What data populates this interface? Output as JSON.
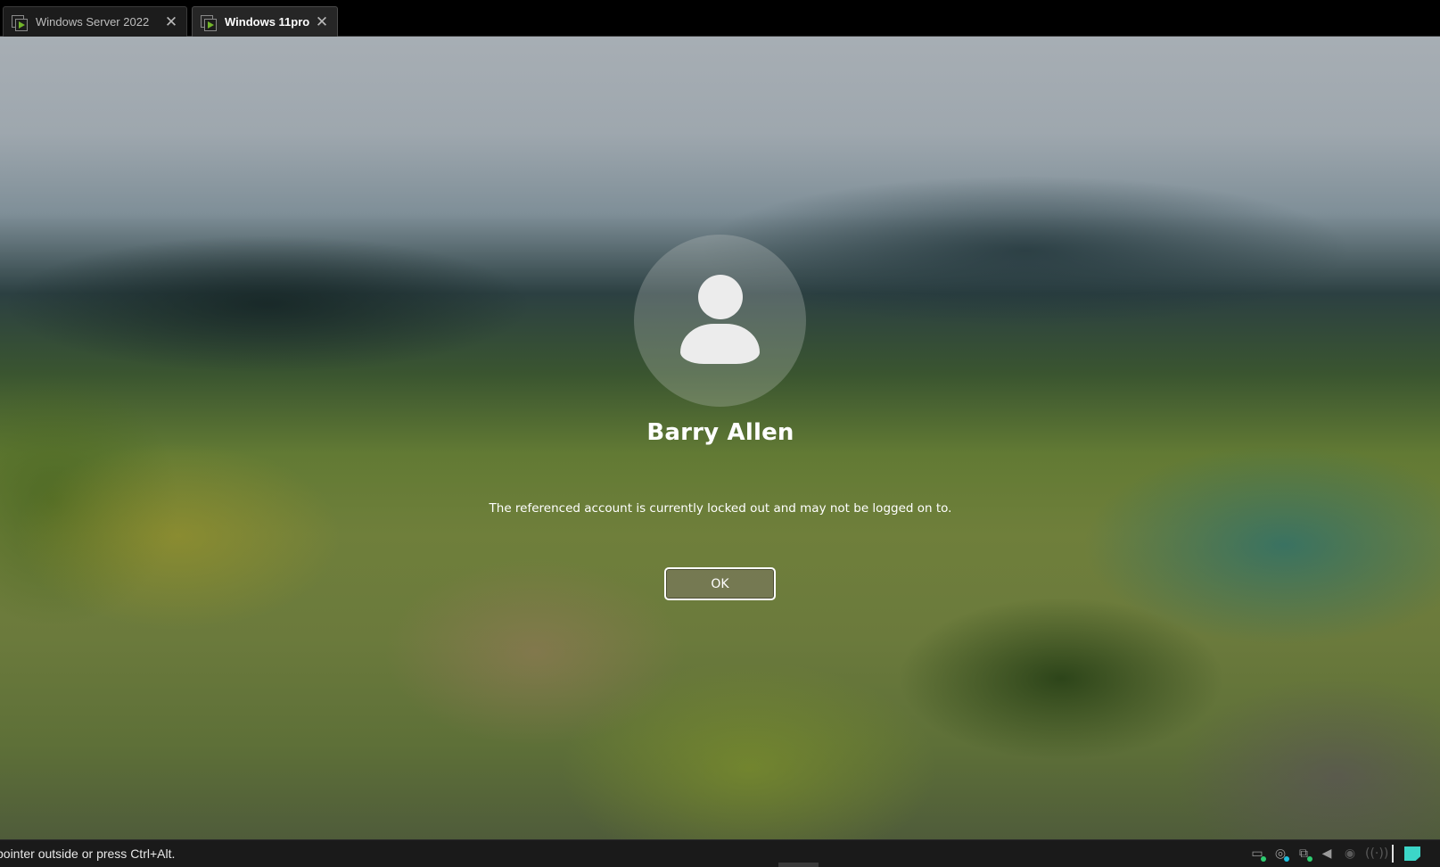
{
  "tabs": [
    {
      "label": "Windows Server 2022",
      "active": false,
      "icon": "vm-icon"
    },
    {
      "label": "Windows 11pro",
      "active": true,
      "icon": "vm-icon"
    }
  ],
  "lock_screen": {
    "user_name": "Barry Allen",
    "message": "The referenced account is currently locked out and may not be logged on to.",
    "ok_button_label": "OK"
  },
  "status_bar": {
    "text": "pointer outside or press Ctrl+Alt.",
    "tray_icons": [
      "hard-disk-icon",
      "optical-drive-icon",
      "network-icon",
      "audio-icon",
      "cd-icon",
      "wireless-icon",
      "note-icon"
    ]
  },
  "colors": {
    "accent_play": "#72b52a",
    "note_icon": "#3cd6c8"
  }
}
